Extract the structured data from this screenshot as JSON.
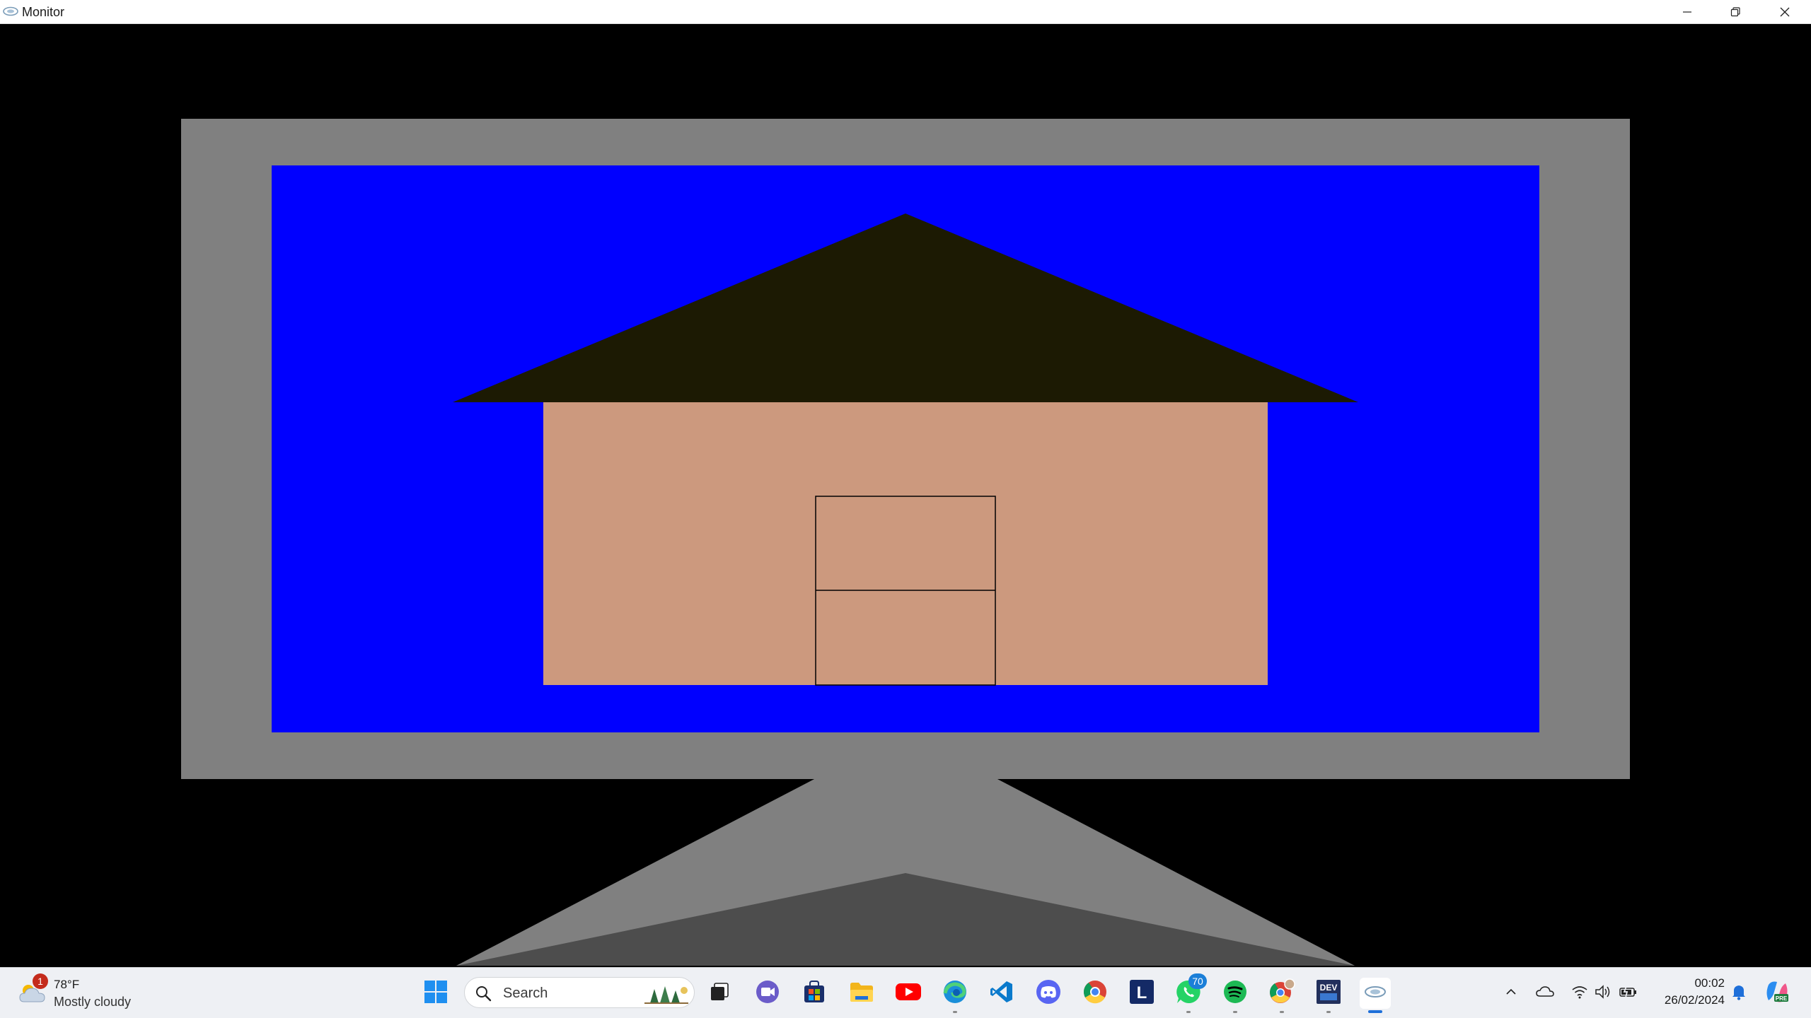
{
  "window": {
    "title": "Monitor",
    "icon": "app-logo-icon",
    "controls": [
      "minimize-icon",
      "restore-icon",
      "close-icon"
    ]
  },
  "scene": {
    "description_colors": {
      "background": "#000000",
      "monitor_frame": "#808080",
      "screen": "#0000ff",
      "roof": "#1c1a03",
      "house_wall": "#cc997e",
      "window_outline": "#000000",
      "stand_light": "#808080",
      "stand_dark": "#4d4d4d"
    }
  },
  "taskbar": {
    "weather": {
      "temperature": "78°F",
      "condition": "Mostly cloudy",
      "badge": "1",
      "icon": "cloudy-weather-icon"
    },
    "search": {
      "placeholder": "Search",
      "icon": "search-icon"
    },
    "apps": [
      {
        "name": "start",
        "icon": "windows-start-icon"
      },
      {
        "name": "task-view",
        "icon": "task-view-icon"
      },
      {
        "name": "meet",
        "icon": "video-call-icon"
      },
      {
        "name": "store",
        "icon": "store-icon"
      },
      {
        "name": "file-explorer",
        "icon": "folder-icon"
      },
      {
        "name": "youtube",
        "icon": "youtube-icon"
      },
      {
        "name": "edge",
        "icon": "edge-icon"
      },
      {
        "name": "vscode",
        "icon": "vscode-icon"
      },
      {
        "name": "discord",
        "icon": "discord-icon"
      },
      {
        "name": "chrome",
        "icon": "chrome-icon"
      },
      {
        "name": "l-app",
        "icon": "l-app-icon",
        "label": "L"
      },
      {
        "name": "whatsapp",
        "icon": "whatsapp-icon",
        "badge": "70"
      },
      {
        "name": "spotify",
        "icon": "spotify-icon"
      },
      {
        "name": "chrome-profile",
        "icon": "chrome-profile-icon"
      },
      {
        "name": "devcpp",
        "icon": "dev-cpp-icon",
        "label": "DEV"
      },
      {
        "name": "monitor-app",
        "icon": "app-logo-icon"
      }
    ],
    "tray": {
      "icons": [
        "chevron-up-icon",
        "onedrive-cloud-icon",
        "wifi-icon",
        "volume-icon",
        "battery-icon"
      ],
      "time": "00:02",
      "date": "26/02/2024",
      "notification_icon": "bell-icon",
      "copilot_icon": "copilot-icon",
      "copilot_label": "PRE"
    }
  }
}
